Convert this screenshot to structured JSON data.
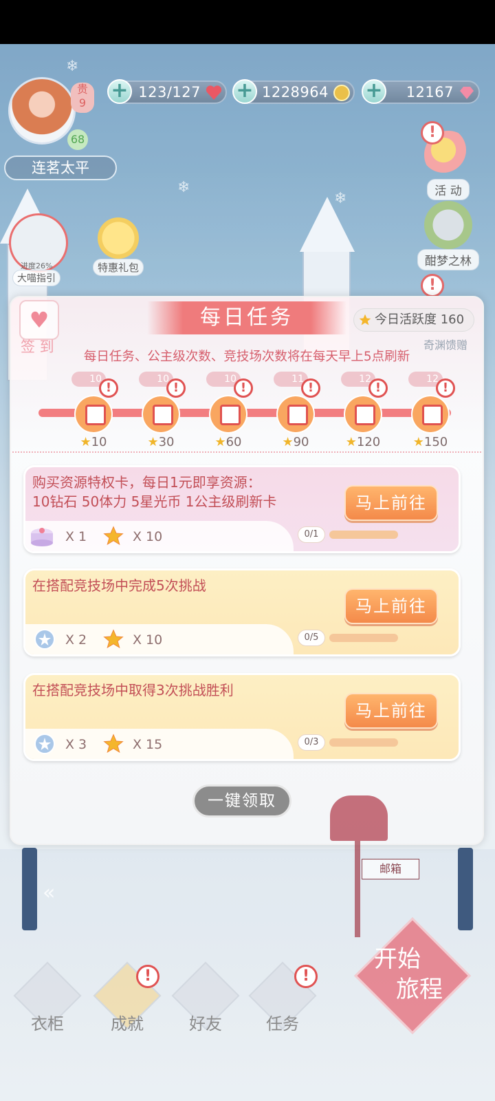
{
  "hud": {
    "stamina": "123/127",
    "gold": "1228964",
    "diamonds": "12167",
    "player_name": "连茗太平",
    "level_badge": "贵\n9",
    "vip_level": "68"
  },
  "side_buttons": {
    "guide_progress": "进度26%",
    "guide_label": "大喵指引",
    "special_pack": "特惠礼包",
    "activity": "活 动",
    "sweet_dream_forest": "酣梦之林",
    "abyss_gift": "奇渊馈赠",
    "sign_in": "签 到"
  },
  "panel": {
    "title": "每日任务",
    "activity_label": "今日活跃度 160",
    "refresh_note": "每日任务、公主级次数、竞技场次数将在每天早上5点刷新",
    "milestones": [
      {
        "gem": "10",
        "threshold": "10"
      },
      {
        "gem": "10",
        "threshold": "30"
      },
      {
        "gem": "10",
        "threshold": "60"
      },
      {
        "gem": "11",
        "threshold": "90"
      },
      {
        "gem": "12",
        "threshold": "120"
      },
      {
        "gem": "12",
        "threshold": "150"
      }
    ],
    "tasks": [
      {
        "desc": "购买资源特权卡，每日1元即享资源：\n10钻石 50体力 5星光币 1公主级刷新卡",
        "reward1_qty": "X 1",
        "reward2_qty": "X 10",
        "button": "马上前往",
        "progress_text": "0/1",
        "progress_value": 0
      },
      {
        "desc": "在搭配竞技场中完成5次挑战",
        "reward1_qty": "X 2",
        "reward2_qty": "X 10",
        "button": "马上前往",
        "progress_text": "0/5",
        "progress_value": 0
      },
      {
        "desc": "在搭配竞技场中取得3次挑战胜利",
        "reward1_qty": "X 3",
        "reward2_qty": "X 15",
        "button": "马上前往",
        "progress_text": "0/3",
        "progress_value": 0
      }
    ],
    "claim_all": "一键领取"
  },
  "bottom_nav": {
    "wardrobe": "衣柜",
    "achievement": "成就",
    "friends": "好友",
    "tasks": "任务",
    "start_line1": "开始",
    "start_line2": "旅程",
    "mailbox": "邮箱"
  },
  "colors": {
    "accent_red": "#ef7b7c",
    "button_orange": "#f48a4a",
    "task_pink": "#f6dbe8",
    "task_yellow": "#fdefc4"
  }
}
